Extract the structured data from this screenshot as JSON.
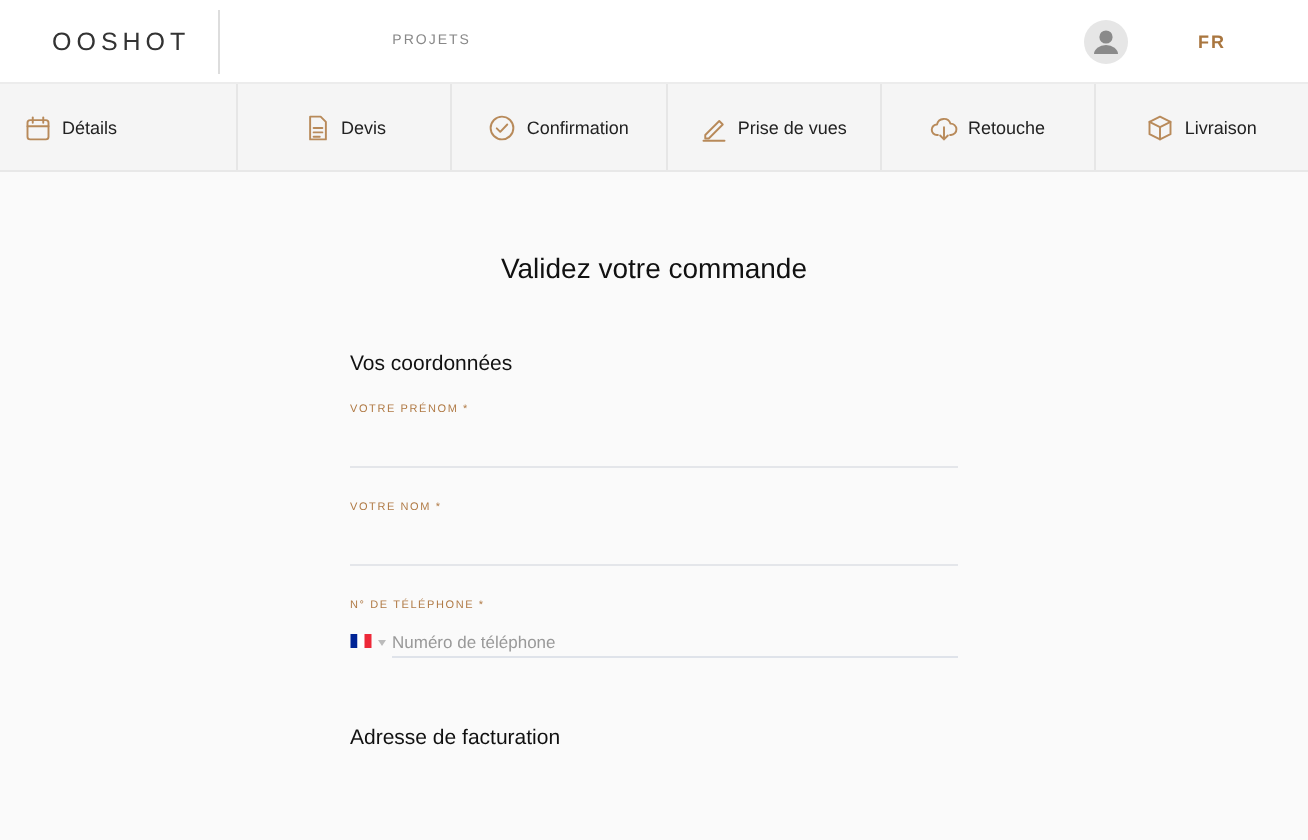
{
  "header": {
    "logo": "OOSHOT",
    "nav_link": "PROJETS",
    "language": "FR"
  },
  "steps": [
    {
      "label": "Détails",
      "kind": "calendar"
    },
    {
      "label": "Devis",
      "kind": "document"
    },
    {
      "label": "Confirmation",
      "kind": "check"
    },
    {
      "label": "Prise de vues",
      "kind": "pencil"
    },
    {
      "label": "Retouche",
      "kind": "cloud"
    },
    {
      "label": "Livraison",
      "kind": "box"
    }
  ],
  "page_title": "Validez votre commande",
  "sections": [
    {
      "title": "Vos coordonnées",
      "fields": [
        {
          "label": "VOTRE PRÉNOM *",
          "kind": "text"
        },
        {
          "label": "VOTRE NOM *",
          "kind": "text"
        },
        {
          "label": "N° DE TÉLÉPHONE *",
          "kind": "phone",
          "placeholder": "Numéro de téléphone"
        }
      ]
    },
    {
      "title": "Adresse de facturation"
    }
  ]
}
